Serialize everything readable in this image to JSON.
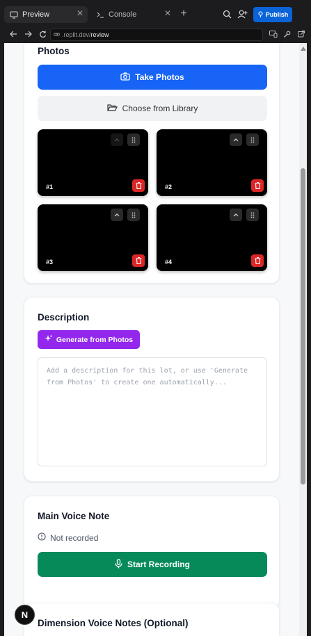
{
  "browser": {
    "tabs": [
      {
        "label": "Preview",
        "icon": "monitor-icon",
        "active": true
      },
      {
        "label": "Console",
        "icon": "terminal-icon",
        "active": false
      }
    ],
    "publish_label": "Publish",
    "url_prefix": ".replit.dev/",
    "url_path": "review"
  },
  "photos": {
    "title": "Photos",
    "take_label": "Take Photos",
    "library_label": "Choose from Library",
    "items": [
      {
        "num": "#1"
      },
      {
        "num": "#2"
      },
      {
        "num": "#3"
      },
      {
        "num": "#4"
      }
    ]
  },
  "description": {
    "title": "Description",
    "generate_label": "Generate from Photos",
    "placeholder": "Add a description for this lot, or use 'Generate from Photos' to create one automatically..."
  },
  "voice": {
    "title": "Main Voice Note",
    "status": "Not recorded",
    "record_label": "Start Recording"
  },
  "dimension": {
    "title": "Dimension Voice Notes (Optional)"
  },
  "fab_label": "N",
  "colors": {
    "primary": "#1764f6",
    "generate": "#9327ee",
    "record": "#068a5a",
    "delete": "#dc2626",
    "publish": "#0b63d8"
  }
}
